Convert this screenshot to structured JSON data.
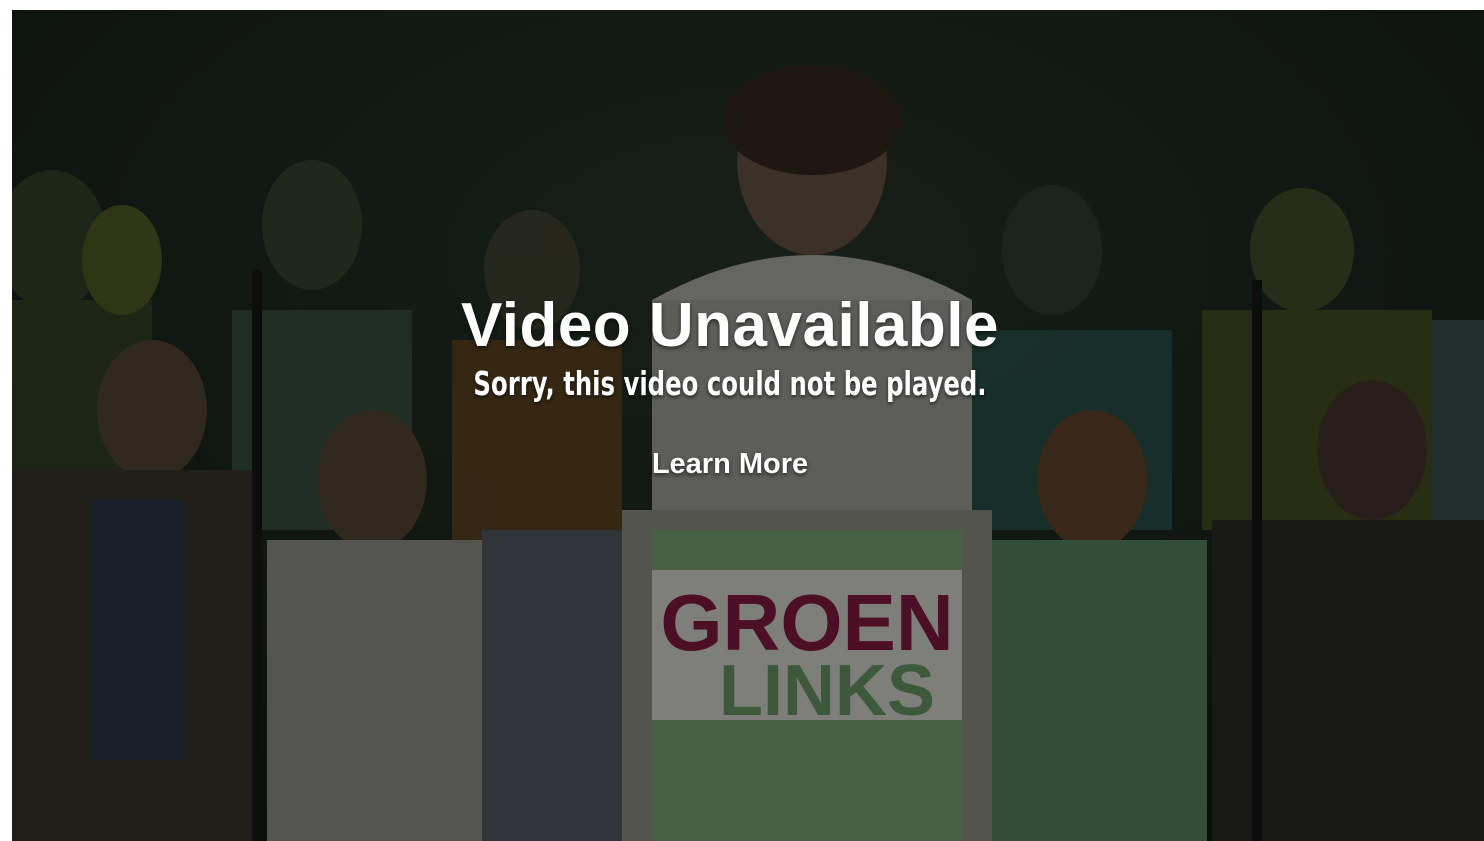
{
  "player": {
    "title": "Video Unavailable",
    "subtitle": "Sorry, this video could not be played.",
    "learn_more_label": "Learn More",
    "poster_sign_line1": "GROEN",
    "poster_sign_line2": "LINKS"
  },
  "colors": {
    "sign_red": "#8b1d44",
    "sign_green": "#7fb27a",
    "overlay_text": "#ffffff"
  }
}
